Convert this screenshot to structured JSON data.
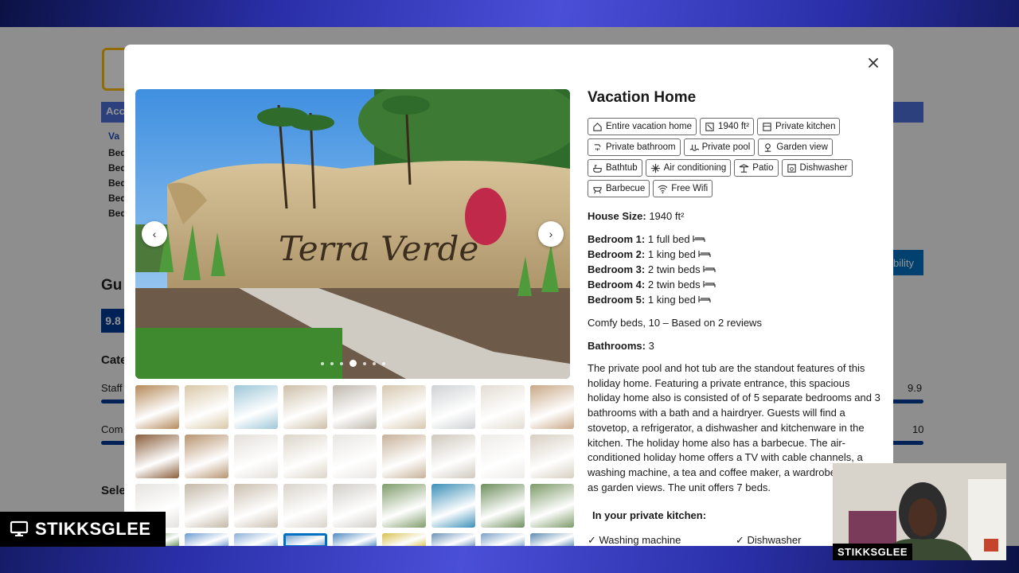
{
  "background_page": {
    "accent_blue": "#003b95",
    "left_labels": [
      "Acc",
      "Va",
      "Bed",
      "Bed",
      "Bed",
      "Bed",
      "Bed"
    ],
    "section_gu": "Gu",
    "score_badge": "9.8",
    "categories_label": "Cate",
    "staff_label": "Staff",
    "staff_score": "9.9",
    "comfort_label": "Com",
    "comfort_score": "10",
    "select_label": "Sele",
    "availability_btn": "bility"
  },
  "modal": {
    "title": "Vacation Home",
    "tags": [
      {
        "icon": "house-icon",
        "label": "Entire vacation home"
      },
      {
        "icon": "size-icon",
        "label": "1940 ft²"
      },
      {
        "icon": "kitchen-icon",
        "label": "Private kitchen"
      },
      {
        "icon": "shower-icon",
        "label": "Private bathroom"
      },
      {
        "icon": "pool-icon",
        "label": "Private pool"
      },
      {
        "icon": "garden-icon",
        "label": "Garden view"
      },
      {
        "icon": "bathtub-icon",
        "label": "Bathtub"
      },
      {
        "icon": "snowflake-icon",
        "label": "Air conditioning"
      },
      {
        "icon": "patio-icon",
        "label": "Patio"
      },
      {
        "icon": "dishwasher-icon",
        "label": "Dishwasher"
      },
      {
        "icon": "barbecue-icon",
        "label": "Barbecue"
      },
      {
        "icon": "wifi-icon",
        "label": "Free Wifi"
      }
    ],
    "house_size_label": "House Size:",
    "house_size_value": "1940 ft²",
    "bedrooms": [
      {
        "label": "Bedroom 1:",
        "value": "1 full bed"
      },
      {
        "label": "Bedroom 2:",
        "value": "1 king bed"
      },
      {
        "label": "Bedroom 3:",
        "value": "2 twin beds"
      },
      {
        "label": "Bedroom 4:",
        "value": "2 twin beds"
      },
      {
        "label": "Bedroom 5:",
        "value": "1 king bed"
      }
    ],
    "reviews_note": "Comfy beds, 10 – Based on 2 reviews",
    "bathrooms_label": "Bathrooms:",
    "bathrooms_value": "3",
    "description": "The private pool and hot tub are the standout features of this holiday home. Featuring a private entrance, this spacious holiday home also is consisted of of 5 separate bedrooms and 3 bathrooms with a bath and a hairdryer. Guests will find a stovetop, a refrigerator, a dishwasher and kitchenware in the kitchen. The holiday home also has a barbecue. The air-conditioned holiday home offers a TV with cable channels, a washing machine, a tea and coffee maker, a wardrobe as well as garden views. The unit offers 7 beds.",
    "kitchen_title": "In your private kitchen:",
    "kitchen_items": [
      "Washing machine",
      "Dishwasher"
    ],
    "photo_sign_text": "Terra Verde",
    "carousel_dots": 7,
    "carousel_active_dot": 3,
    "selected_thumbnail": 30
  },
  "overlay": {
    "brand_name": "STIKKSGLEE",
    "webcam_label": "STIKKSGLEE"
  }
}
